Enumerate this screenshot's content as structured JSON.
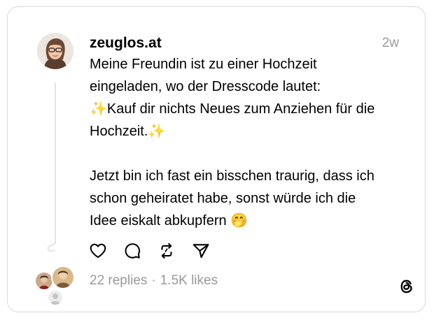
{
  "post": {
    "username": "zeuglos.at",
    "time": "2w",
    "text": "Meine Freundin ist zu einer Hochzeit\neingeladen, wo der Dresscode lautet:\n✨Kauf dir nichts Neues zum Anziehen für die\nHochzeit.✨\n\nJetzt bin ich fast ein bisschen traurig, dass ich\nschon geheiratet habe, sonst würde ich die\nIdee eiskalt abkupfern 🤭"
  },
  "stats": {
    "replies": "22 replies",
    "separator": "·",
    "likes": "1.5K likes"
  },
  "icons": {
    "like": "heart-icon",
    "reply": "comment-icon",
    "repost": "repost-icon",
    "share": "send-icon",
    "brand": "threads-logo-icon"
  },
  "colors": {
    "text": "#000000",
    "muted": "#999999",
    "border": "#d9d9d9"
  }
}
